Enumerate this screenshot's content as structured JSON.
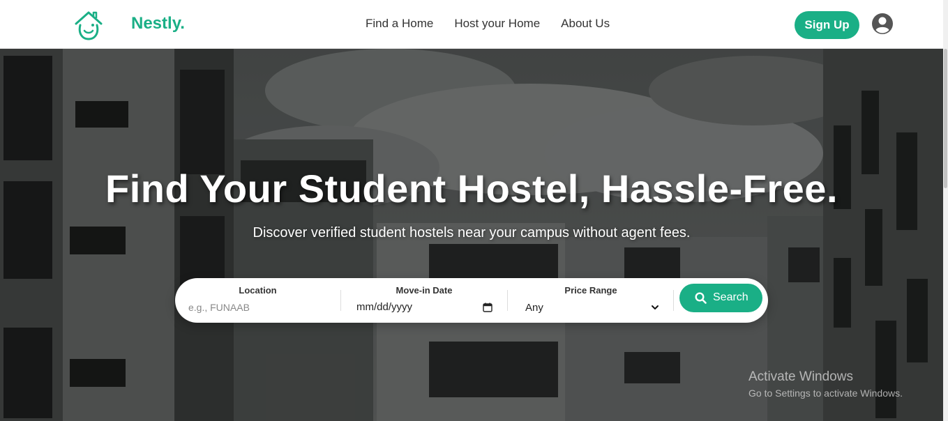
{
  "brand": {
    "name": "Nestly.",
    "color": "#1aaf86"
  },
  "nav": {
    "links": [
      "Find a Home",
      "Host your Home",
      "About Us"
    ],
    "signup_label": "Sign Up",
    "profile_icon": "user-circle-icon"
  },
  "hero": {
    "title": "Find Your Student Hostel, Hassle-Free.",
    "subtitle": "Discover verified student hostels near your campus without agent fees."
  },
  "search": {
    "location": {
      "label": "Location",
      "placeholder": "e.g., FUNAAB",
      "value": ""
    },
    "move_in": {
      "label": "Move-in Date",
      "value": "mm/dd/yyyy",
      "icon": "calendar-icon"
    },
    "price": {
      "label": "Price Range",
      "selected": "Any",
      "icon": "chevron-down-icon"
    },
    "button_label": "Search",
    "button_icon": "search-icon"
  },
  "watermark": {
    "title": "Activate Windows",
    "subtitle": "Go to Settings to activate Windows."
  }
}
